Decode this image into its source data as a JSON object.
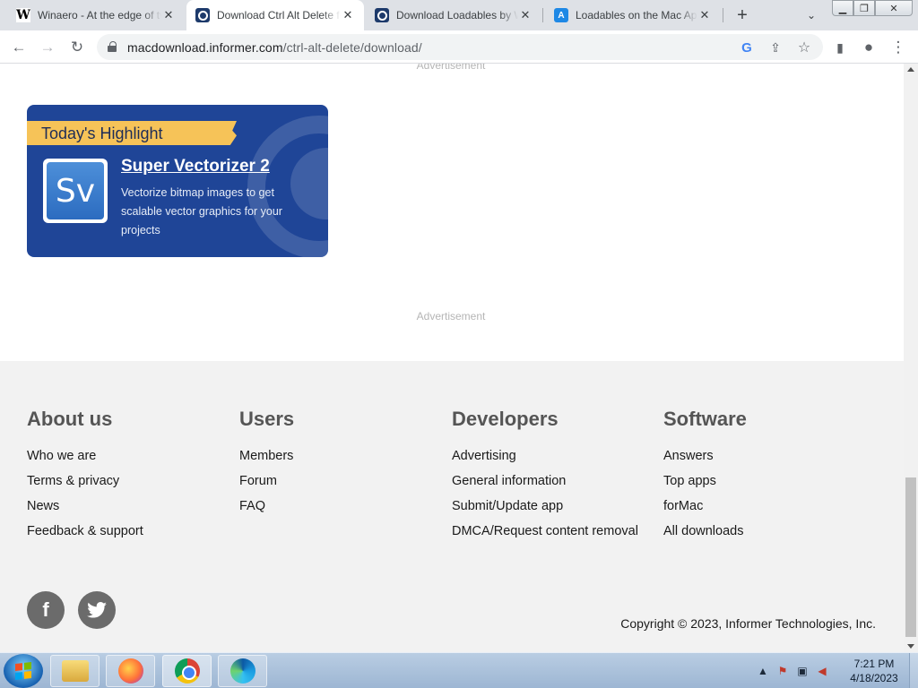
{
  "browser": {
    "tabs": [
      {
        "title": "Winaero - At the edge of tweaking",
        "favicon": "W",
        "active": false
      },
      {
        "title": "Download Ctrl Alt Delete for Mac",
        "favicon": "Q",
        "active": true
      },
      {
        "title": "Download Loadables by Whiskey",
        "favicon": "Q",
        "active": false
      },
      {
        "title": "Loadables on the Mac App Store",
        "favicon": "A",
        "active": false
      }
    ],
    "new_tab_icon": "plus-icon",
    "url_host": "macdownload.informer.com",
    "url_path": "/ctrl-alt-delete/download/",
    "omnibox_icons": [
      "google-lens-icon",
      "share-icon",
      "star-icon"
    ],
    "toolbar_icons": [
      "side-panel-icon",
      "profile-icon",
      "kebab-menu-icon"
    ]
  },
  "page": {
    "ad_top": "Advertisement",
    "ad_middle": "Advertisement",
    "highlight": {
      "ribbon": "Today's Highlight",
      "app_icon_text": "Sv",
      "title": "Super Vectorizer 2",
      "description": "Vectorize bitmap images to get scalable vector graphics for your projects",
      "accent_color": "#1f4597",
      "ribbon_color": "#f6c358"
    },
    "footer": {
      "columns": [
        {
          "heading": "About us",
          "links": [
            "Who we are",
            "Terms & privacy",
            "News",
            "Feedback & support"
          ]
        },
        {
          "heading": "Users",
          "links": [
            "Members",
            "Forum",
            "FAQ"
          ]
        },
        {
          "heading": "Developers",
          "links": [
            "Advertising",
            "General information",
            "Submit/Update app",
            "DMCA/Request content removal"
          ]
        },
        {
          "heading": "Software",
          "links": [
            "Answers",
            "Top apps",
            "forMac",
            "All downloads"
          ]
        }
      ],
      "social": [
        "facebook-icon",
        "twitter-icon"
      ],
      "copyright": "Copyright © 2023, Informer Technologies, Inc."
    }
  },
  "taskbar": {
    "pinned": [
      "explorer-icon",
      "firefox-icon",
      "chrome-icon",
      "edge-icon"
    ],
    "clock_time": "7:21 PM",
    "clock_date": "4/18/2023"
  }
}
